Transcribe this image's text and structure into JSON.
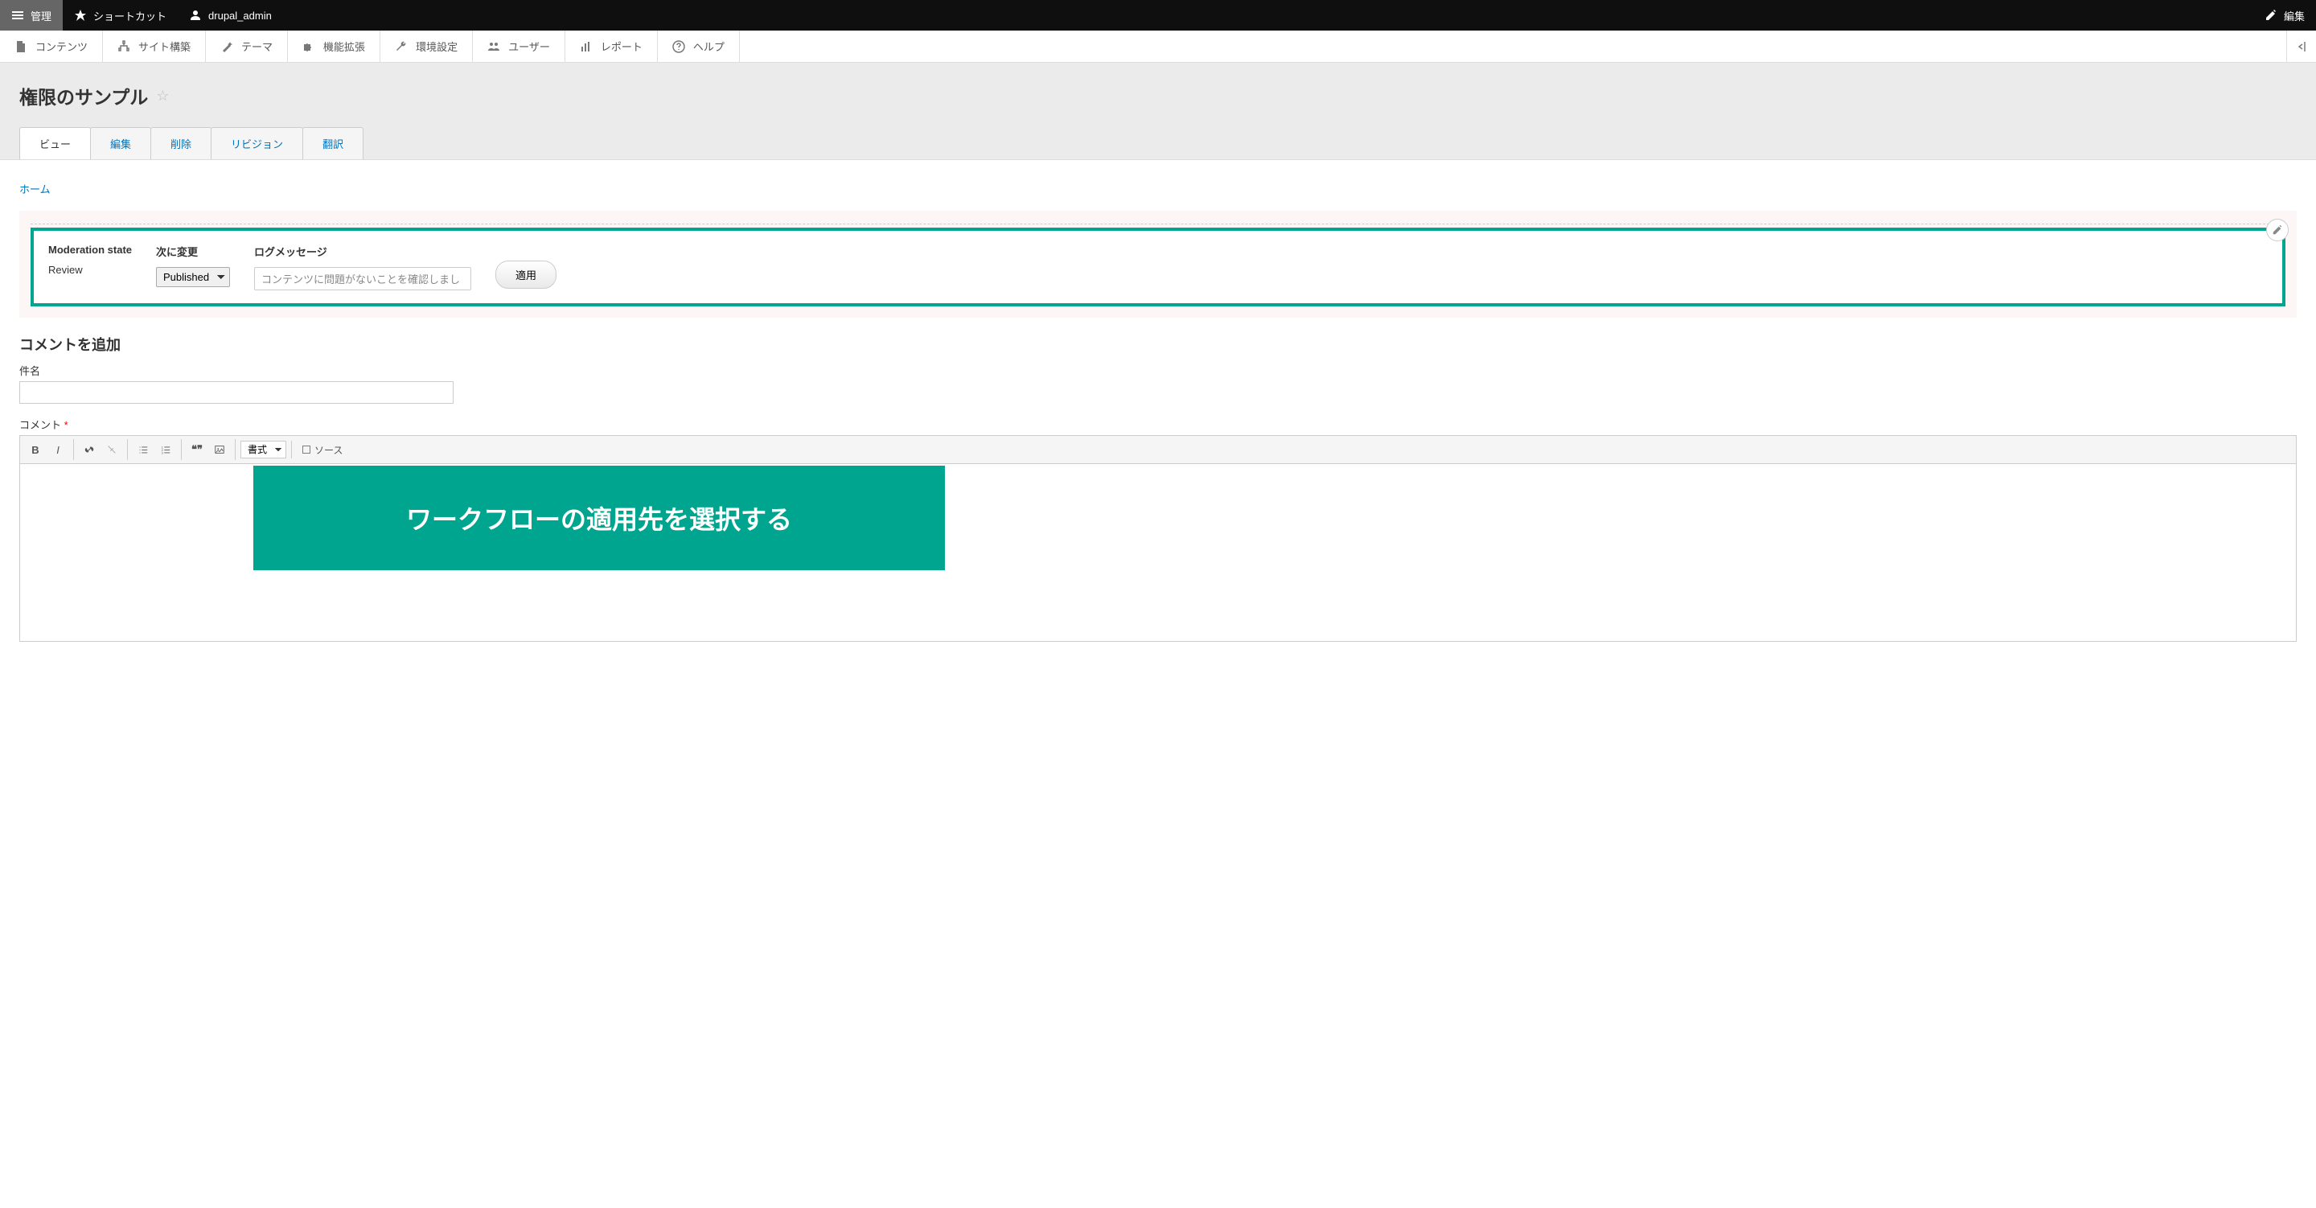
{
  "topbar": {
    "manage": "管理",
    "shortcuts": "ショートカット",
    "user": "drupal_admin",
    "edit": "編集"
  },
  "subnav": {
    "content": "コンテンツ",
    "structure": "サイト構築",
    "appearance": "テーマ",
    "extend": "機能拡張",
    "config": "環境設定",
    "people": "ユーザー",
    "reports": "レポート",
    "help": "ヘルプ"
  },
  "page": {
    "title": "権限のサンプル"
  },
  "tabs": {
    "view": "ビュー",
    "edit": "編集",
    "delete": "削除",
    "revisions": "リビジョン",
    "translate": "翻訳"
  },
  "breadcrumb": {
    "home": "ホーム"
  },
  "moderation": {
    "state_label": "Moderation state",
    "state_value": "Review",
    "change_label": "次に変更",
    "change_value": "Published",
    "log_label": "ログメッセージ",
    "log_value": "コンテンツに問題がないことを確認しまし",
    "apply": "適用"
  },
  "comment": {
    "heading": "コメントを追加",
    "subject_label": "件名",
    "body_label": "コメント"
  },
  "editor": {
    "format_label": "書式",
    "source_label": "ソース"
  },
  "banner": {
    "text": "ワークフローの適用先を選択する"
  }
}
